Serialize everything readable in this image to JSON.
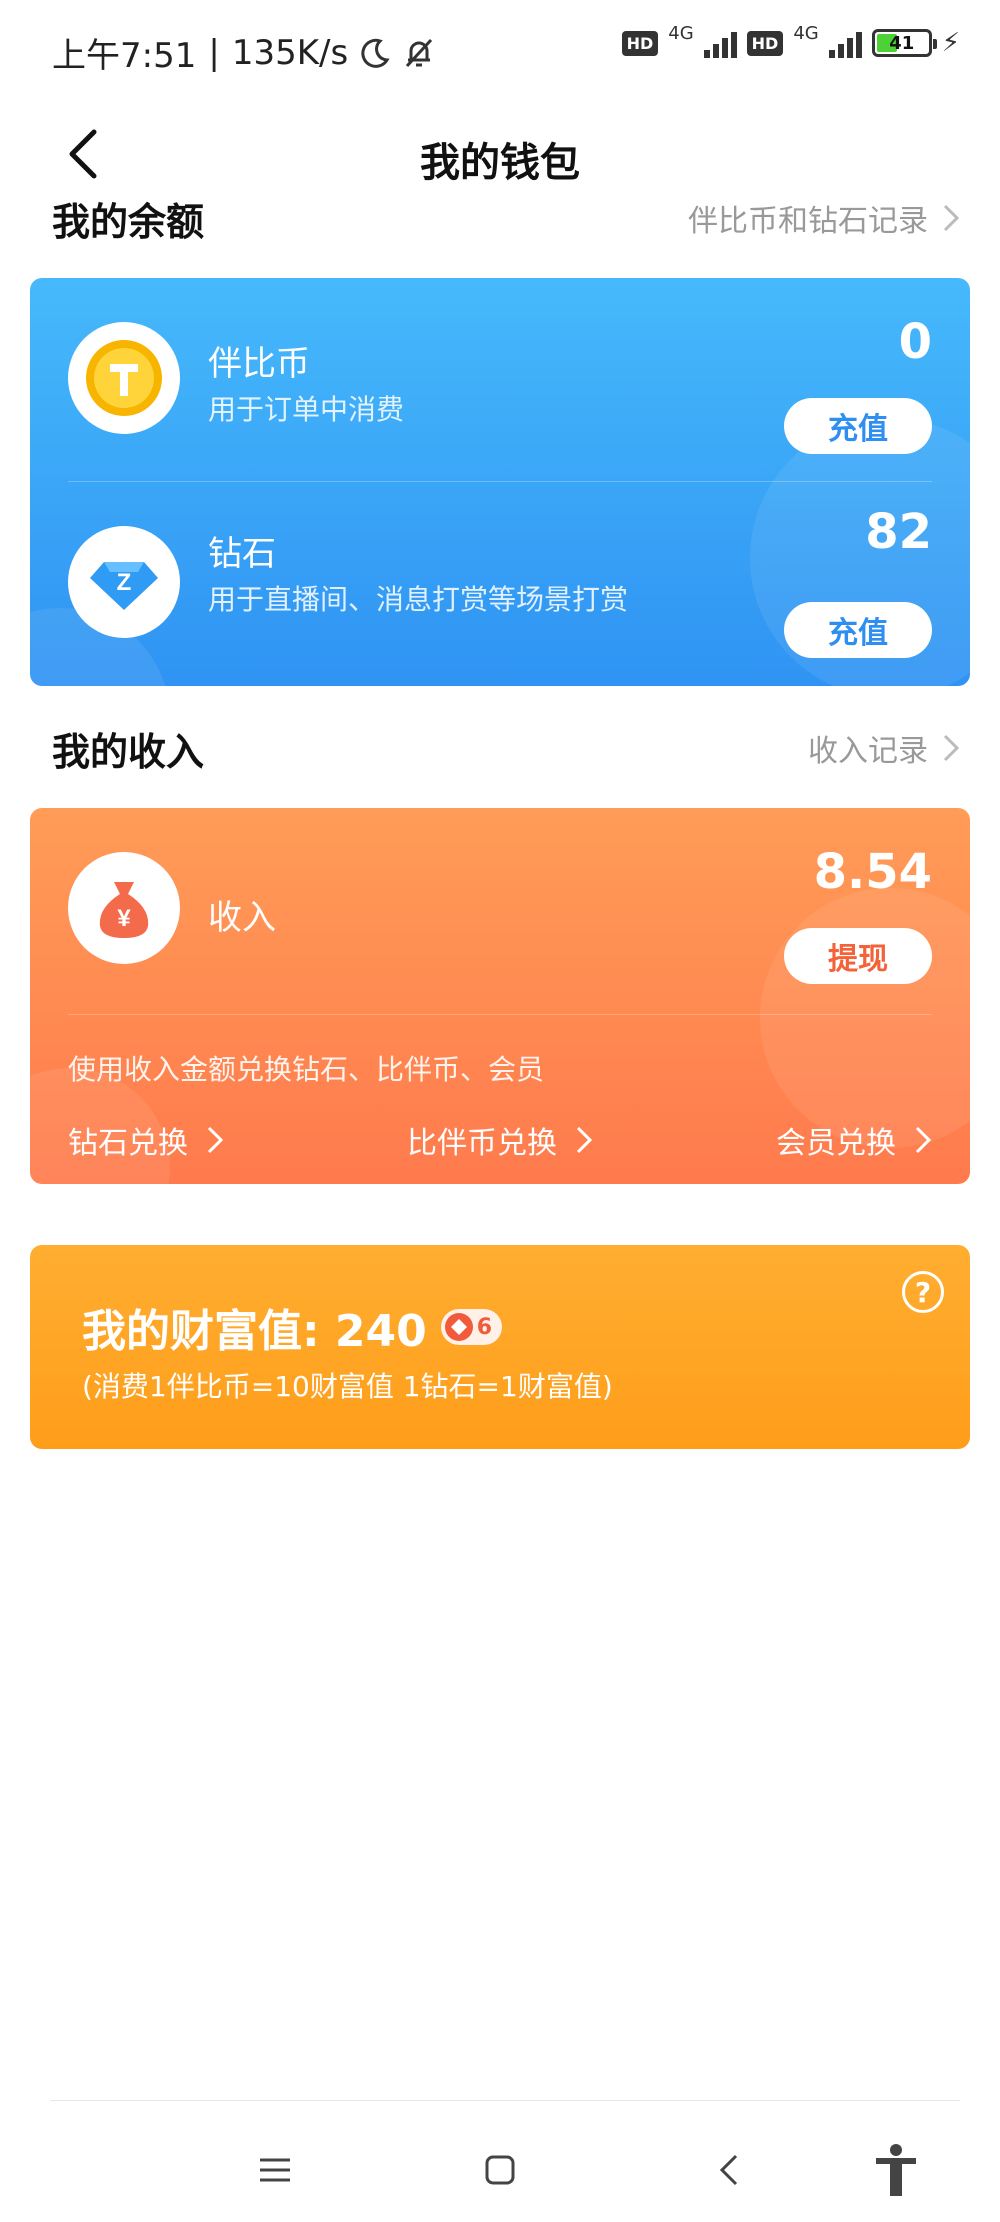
{
  "status_bar": {
    "time": "上午7:51",
    "separator": "|",
    "speed": "135K/s",
    "hd1": "HD",
    "net1": "4G",
    "hd2": "HD",
    "net2": "4G",
    "battery": "41"
  },
  "header": {
    "title": "我的钱包"
  },
  "balance": {
    "section_title": "我的余额",
    "record_link": "伴比币和钻石记录",
    "coin": {
      "name": "伴比币",
      "desc": "用于订单中消费",
      "amount": "0",
      "button": "充值"
    },
    "diamond": {
      "name": "钻石",
      "desc": "用于直播间、消息打赏等场景打赏",
      "amount": "82",
      "button": "充值"
    }
  },
  "income": {
    "section_title": "我的收入",
    "record_link": "收入记录",
    "name": "收入",
    "amount": "8.54",
    "button": "提现",
    "exchange_desc": "使用收入金额兑换钻石、比伴币、会员",
    "exchanges": [
      "钻石兑换",
      "比伴币兑换",
      "会员兑换"
    ]
  },
  "wealth": {
    "title": "我的财富值: 240",
    "level": "6",
    "rule": "(消费1伴比币=10财富值 1钻石=1财富值)"
  },
  "colors": {
    "blue_card": "#3aa6f8",
    "orange_card": "#ff8a52",
    "gold_card": "#ffa626"
  }
}
